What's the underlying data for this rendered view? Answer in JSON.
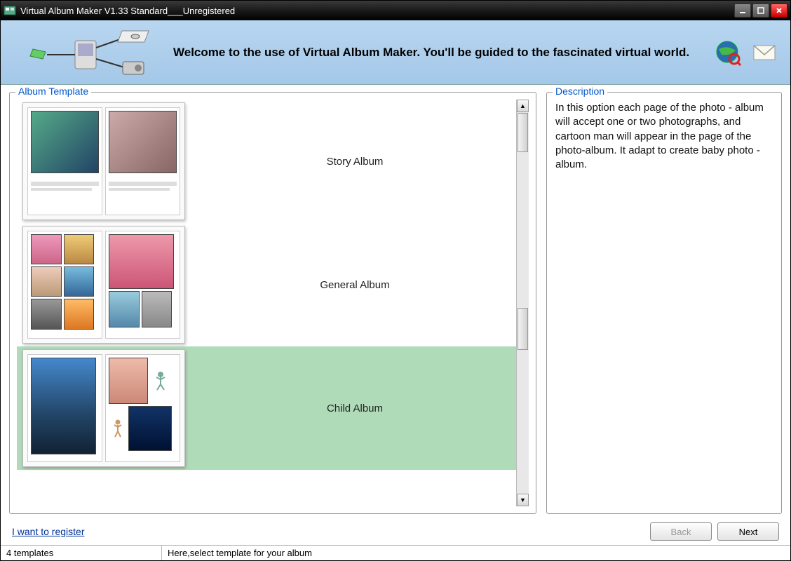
{
  "window": {
    "title": "Virtual Album Maker V1.33 Standard___Unregistered"
  },
  "banner": {
    "welcome": "Welcome to the use of Virtual Album Maker. You'll be guided to the fascinated virtual world."
  },
  "template_panel": {
    "legend": "Album Template",
    "items": [
      {
        "label": "Story Album"
      },
      {
        "label": "General Album"
      },
      {
        "label": "Child Album"
      }
    ],
    "selected_index": 2
  },
  "description_panel": {
    "legend": "Description",
    "text": "In this option each page of the photo - album will accept one or two photographs, and cartoon man will appear in the page of the photo-album. It adapt to create baby photo - album."
  },
  "footer": {
    "register_link": "I want to register",
    "back": "Back",
    "next": "Next"
  },
  "statusbar": {
    "count": "4 templates",
    "hint": "Here,select template for your album"
  }
}
